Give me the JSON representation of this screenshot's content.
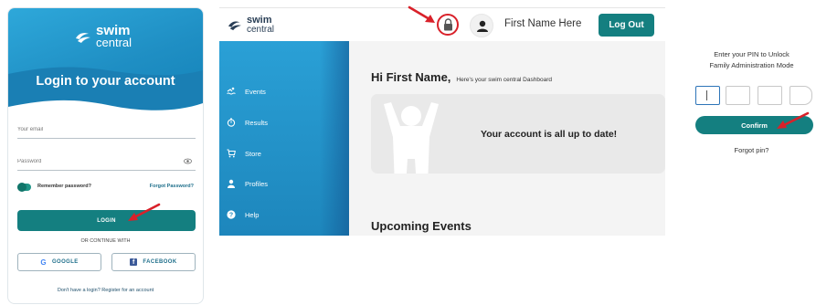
{
  "login": {
    "brand_line1": "swim",
    "brand_line2": "central",
    "title": "Login to your account",
    "email_placeholder": "Your email",
    "password_placeholder": "Password",
    "remember_label": "Remember password?",
    "forgot_password": "Forgot Password?",
    "login_button": "LOGIN",
    "continue_with": "OR CONTINUE WITH",
    "google_button": "GOOGLE",
    "facebook_button": "FACEBOOK",
    "register_text": "Don't have a login? Register for an account",
    "accent_color": "#147f80"
  },
  "dashboard": {
    "brand_line1": "swim",
    "brand_line2": "central",
    "user_name": "First Name Here",
    "logout_button": "Log Out",
    "nav": [
      {
        "label": "Events",
        "icon": "swimmer-icon"
      },
      {
        "label": "Results",
        "icon": "stopwatch-icon"
      },
      {
        "label": "Store",
        "icon": "cart-icon"
      },
      {
        "label": "Profiles",
        "icon": "person-icon"
      },
      {
        "label": "Help",
        "icon": "question-icon"
      }
    ],
    "greeting_title": "Hi First Name,",
    "greeting_sub": "Here's your swim central Dashboard",
    "status_message": "Your account is all up to date!",
    "upcoming_title": "Upcoming Events",
    "highlight_color": "#d9212a"
  },
  "pin": {
    "prompt_line1": "Enter your PIN to Unlock",
    "prompt_line2": "Family Administration Mode",
    "confirm_button": "Confirm",
    "forgot_pin": "Forgot pin?"
  }
}
